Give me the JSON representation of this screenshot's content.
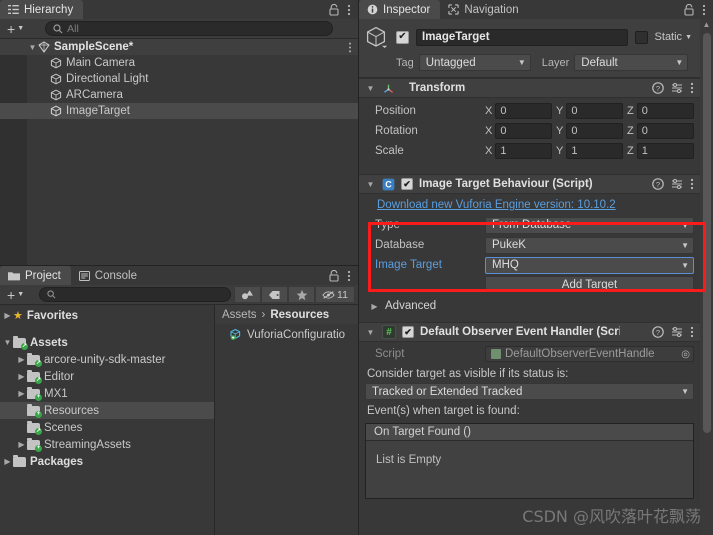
{
  "hierarchy": {
    "tab_label": "Hierarchy",
    "tab_icon": "hierarchy-icon",
    "lock_icon": "lock-icon",
    "menu_icon": "kebab-menu-icon",
    "create_label": "+",
    "search_placeholder": "All",
    "search_value": "",
    "scene": {
      "label": "SampleScene*",
      "icon": "scene-icon"
    },
    "items": [
      {
        "label": "Main Camera",
        "icon": "gameobject-icon"
      },
      {
        "label": "Directional Light",
        "icon": "gameobject-icon"
      },
      {
        "label": "ARCamera",
        "icon": "gameobject-icon"
      },
      {
        "label": "ImageTarget",
        "icon": "gameobject-icon",
        "selected": true
      }
    ]
  },
  "project": {
    "tabs": [
      {
        "label": "Project",
        "icon": "folder-icon",
        "active": true
      },
      {
        "label": "Console",
        "icon": "console-icon",
        "active": false
      }
    ],
    "lock_icon": "lock-icon",
    "menu_icon": "kebab-menu-icon",
    "create_label": "+",
    "search_placeholder": "",
    "filters": [
      {
        "name": "type-filter-icon"
      },
      {
        "name": "label-filter-icon"
      },
      {
        "name": "favorite-star-icon"
      }
    ],
    "hidden_count": "11",
    "hidden_icon": "hidden-eye-icon",
    "favorites_label": "Favorites",
    "tree": [
      {
        "label": "Assets",
        "depth": 0,
        "arrow": "down",
        "badge": "link"
      },
      {
        "label": "arcore-unity-sdk-master",
        "depth": 1,
        "arrow": "right",
        "badge": "link"
      },
      {
        "label": "Editor",
        "depth": 1,
        "arrow": "right",
        "badge": "link"
      },
      {
        "label": "MX1",
        "depth": 1,
        "arrow": "right",
        "badge": "plus"
      },
      {
        "label": "Resources",
        "depth": 1,
        "arrow": "none",
        "badge": "plus",
        "selected": true
      },
      {
        "label": "Scenes",
        "depth": 1,
        "arrow": "none",
        "badge": "link"
      },
      {
        "label": "StreamingAssets",
        "depth": 1,
        "arrow": "right",
        "badge": "plus"
      },
      {
        "label": "Packages",
        "depth": 0,
        "arrow": "right",
        "badge": "none"
      }
    ],
    "breadcrumb": [
      "Assets",
      "Resources"
    ],
    "breadcrumb_sep": "›",
    "assets": [
      {
        "label": "VuforiaConfiguratio",
        "icon": "prefab-icon"
      }
    ]
  },
  "inspector": {
    "tabs": [
      {
        "label": "Inspector",
        "icon": "info-icon",
        "active": true
      },
      {
        "label": "Navigation",
        "icon": "navigation-icon",
        "active": false
      }
    ],
    "lock_icon": "lock-icon",
    "menu_icon": "kebab-menu-icon",
    "object": {
      "icon": "gameobject-cube-icon",
      "enabled": true,
      "name": "ImageTarget",
      "static_label": "Static",
      "static_checked": false,
      "tag_label": "Tag",
      "tag_value": "Untagged",
      "layer_label": "Layer",
      "layer_value": "Default"
    },
    "transform": {
      "title": "Transform",
      "icon": "transform-icon",
      "help_icon": "help-icon",
      "preset_icon": "preset-icon",
      "menu_icon": "kebab-menu-icon",
      "rows": [
        {
          "label": "Position",
          "x": "0",
          "y": "0",
          "z": "0"
        },
        {
          "label": "Rotation",
          "x": "0",
          "y": "0",
          "z": "0"
        },
        {
          "label": "Scale",
          "x": "1",
          "y": "1",
          "z": "1"
        }
      ],
      "axis_labels": [
        "X",
        "Y",
        "Z"
      ]
    },
    "image_target_behaviour": {
      "title": "Image Target Behaviour (Script)",
      "icon": "script-icon",
      "enabled": true,
      "help_icon": "help-icon",
      "preset_icon": "preset-icon",
      "menu_icon": "kebab-menu-icon",
      "download_link": "Download new Vuforia Engine version: 10.10.2",
      "fields": [
        {
          "label": "Type",
          "value": "From Database",
          "highlight": false
        },
        {
          "label": "Database",
          "value": "PukeK",
          "highlight": false
        },
        {
          "label": "Image Target",
          "value": "MHQ",
          "highlight": true
        }
      ],
      "add_target_label": "Add Target",
      "advanced_label": "Advanced"
    },
    "default_observer_event_handler": {
      "title": "Default Observer Event Handler (Scri",
      "icon": "csharp-script-icon",
      "enabled": true,
      "help_icon": "help-icon",
      "preset_icon": "preset-icon",
      "menu_icon": "kebab-menu-icon",
      "script_label": "Script",
      "script_value": "DefaultObserverEventHandle",
      "script_picker_icon": "object-picker-icon",
      "status_label": "Consider target as visible if its status is:",
      "status_value": "Tracked or Extended Tracked",
      "events_label": "Event(s) when target is found:",
      "event_header": "On Target Found ()",
      "event_empty": "List is Empty"
    },
    "scroll": {
      "up_arrow": "scroll-up-arrow",
      "down_arrow": "scroll-down-arrow"
    }
  },
  "annotation": {
    "highlight_color": "#fc1b1b"
  },
  "watermark": "CSDN @风吹落叶花飘荡"
}
